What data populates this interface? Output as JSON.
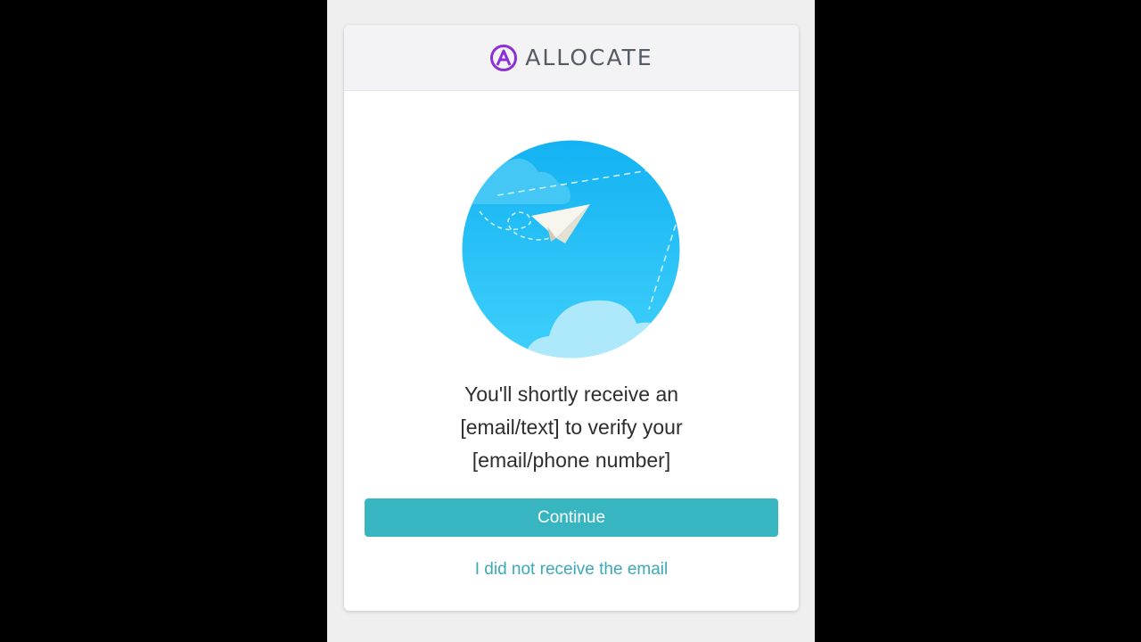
{
  "header": {
    "brand_name": "ALLOCATE",
    "logo_icon": "allocate-a-icon",
    "brand_color": "#8c2fd6"
  },
  "illustration": {
    "icon": "paper-plane-sky-illustration",
    "sky_color": "#2fc4f5"
  },
  "main": {
    "message": "You'll shortly receive an\n[email/text] to verify your\n[email/phone number]",
    "continue_label": "Continue",
    "resend_label": "I did not receive the email",
    "accent_color": "#37b6c2"
  }
}
